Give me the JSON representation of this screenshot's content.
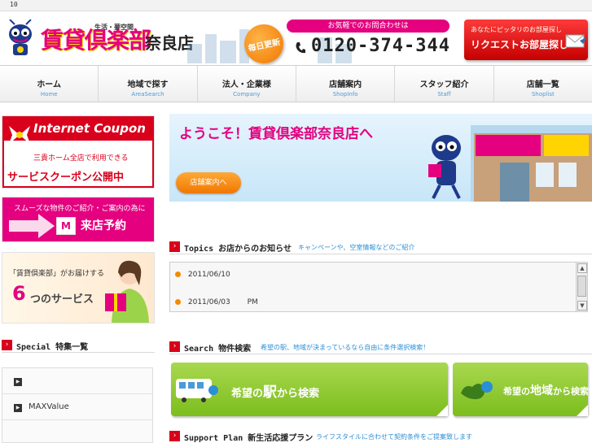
{
  "topbar": {
    "counter": "10"
  },
  "header": {
    "logo_text": "賃貸倶楽部",
    "logo_sub": "生活・夢空間",
    "store_name": "奈良店",
    "daily_badge": "毎日更新",
    "contact_label": "お気軽でのお問合わせは",
    "phone": "0120-374-344",
    "request_small": "あなたにピッタリのお部屋探し",
    "request_big": "リクエストお部屋探し"
  },
  "nav": [
    {
      "jp": "ホーム",
      "en": "Home"
    },
    {
      "jp": "地域で探す",
      "en": "AreaSearch"
    },
    {
      "jp": "法人・企業様",
      "en": "Company"
    },
    {
      "jp": "店舗案内",
      "en": "ShopInfo"
    },
    {
      "jp": "スタッフ紹介",
      "en": "Staff"
    },
    {
      "jp": "店舗一覧",
      "en": "Shoplist"
    }
  ],
  "sidebar": {
    "coupon_title": "Internet Coupon",
    "coupon_line1": "三貴ホーム全店で利用できる",
    "coupon_line2": "サービスクーポン公開中",
    "reserve_line1": "スムーズな物件のご紹介・ご案内の為に",
    "reserve_logo": "M",
    "reserve_line2": "来店予約",
    "six_line1": "「賃貸倶楽部」がお届けする",
    "six_number": "6",
    "six_line2": "つのサービス",
    "special_title": "Special 特集一覧",
    "special_items": [
      "",
      "MAXValue"
    ]
  },
  "main": {
    "welcome_title": "ようこそ！賃貸倶楽部奈良店へ",
    "store_button": "店舗案内へ",
    "topics": {
      "title": "Topics お店からのお知らせ",
      "sub": "キャンペーンや、空室情報などのご紹介"
    },
    "news": [
      {
        "date": "2011/06/10",
        "text": ""
      },
      {
        "date": "2011/06/03",
        "text": "PM"
      }
    ],
    "search": {
      "title": "Search 物件検索",
      "sub": "希望の駅、地域が決まっているなら自由に条件選択検索！"
    },
    "search_station": {
      "pre": "希望の",
      "big": "駅",
      "post": "から検索"
    },
    "search_area": {
      "pre": "希望の",
      "big": "地域",
      "post": "から検索"
    },
    "support": {
      "title": "Support Plan 新生活応援プラン",
      "sub": "ライフスタイルに合わせて契約条件をご提案致します"
    }
  },
  "colors": {
    "brand_pink": "#e4007f",
    "brand_red": "#d9001b",
    "accent_orange": "#f07800",
    "search_green": "#7cbd1d",
    "link_blue": "#2a8fd6"
  }
}
